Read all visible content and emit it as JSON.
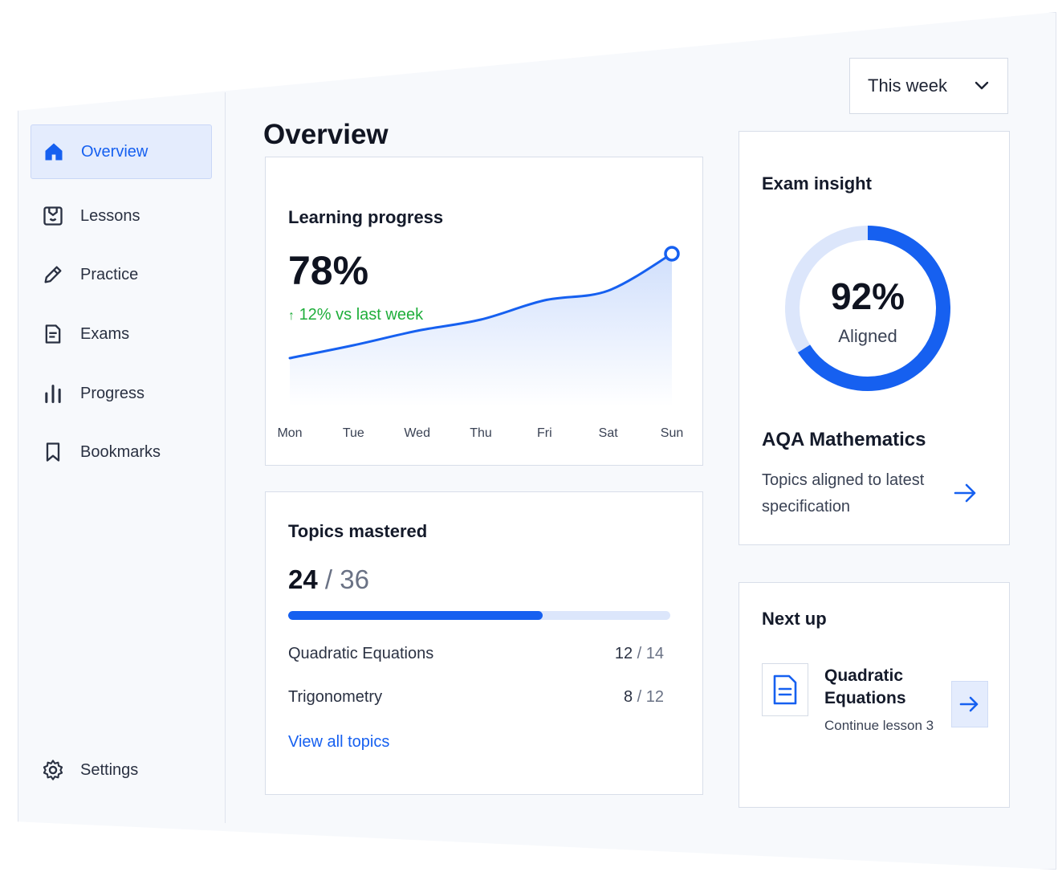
{
  "sidebar": {
    "items": [
      {
        "label": "Overview",
        "icon": "home-icon",
        "active": true
      },
      {
        "label": "Lessons",
        "icon": "lessons-icon",
        "active": false
      },
      {
        "label": "Practice",
        "icon": "pencil-icon",
        "active": false
      },
      {
        "label": "Exams",
        "icon": "exam-document-icon",
        "active": false
      },
      {
        "label": "Progress",
        "icon": "bar-chart-icon",
        "active": false
      },
      {
        "label": "Bookmarks",
        "icon": "bookmark-icon",
        "active": false
      }
    ],
    "settings_label": "Settings"
  },
  "header": {
    "title": "Overview",
    "period_select": "This week"
  },
  "learning_progress": {
    "title": "Learning progress",
    "value": "78%",
    "trend_arrow": "↑",
    "trend_text": "12% vs last week"
  },
  "chart_data": {
    "type": "area",
    "title": "",
    "categories": [
      "Mon",
      "Tue",
      "Wed",
      "Thu",
      "Fri",
      "Sat",
      "Sun"
    ],
    "series": [
      {
        "values": [
          30,
          38,
          47,
          54,
          66,
          72,
          95
        ]
      }
    ],
    "ylim": [
      0,
      100
    ],
    "grid": false,
    "accent_color": "#1660f0"
  },
  "topics_mastered": {
    "title": "Topics mastered",
    "mastered": "24",
    "total": "/ 36",
    "progress_fraction": 0.667,
    "rows": [
      {
        "name": "Quadratic Equations",
        "done": "12",
        "total": "/ 14"
      },
      {
        "name": "Trigonometry",
        "done": "8",
        "total": "/ 12"
      }
    ],
    "link": "View all topics"
  },
  "exam_insight": {
    "title": "Exam insight",
    "percent": "92%",
    "percent_fraction": 0.66,
    "status": "Aligned",
    "board": "AQA Mathematics",
    "description": "Topics aligned to latest specification"
  },
  "next_up": {
    "title": "Next up",
    "lesson_title": "Quadratic Equations",
    "lesson_sub": "Continue lesson 3"
  },
  "colors": {
    "accent": "#1660f0",
    "trend_positive": "#1fae3b",
    "track": "#dce6fb"
  }
}
